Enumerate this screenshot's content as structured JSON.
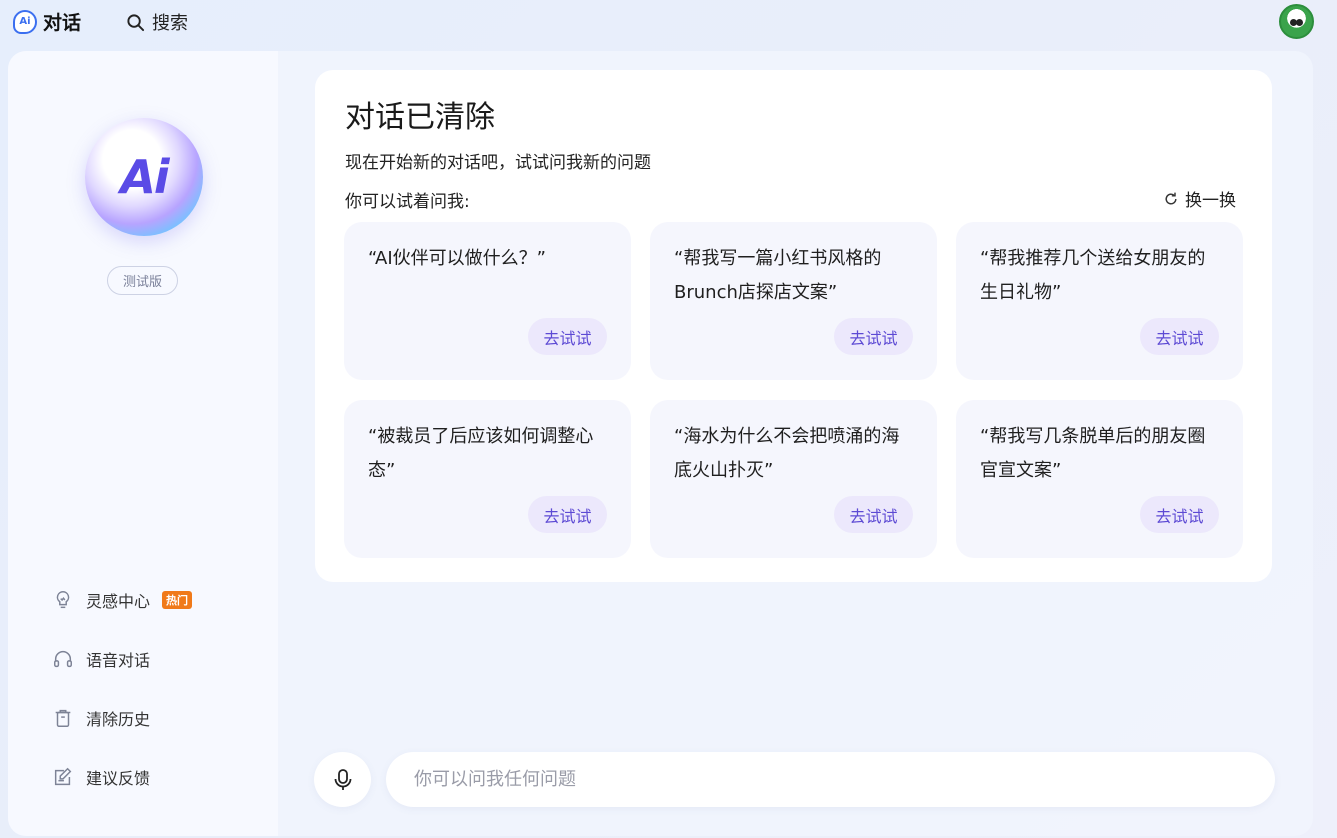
{
  "app": {
    "logo_text": "Ai",
    "title": "对话"
  },
  "topbar": {
    "search_label": "搜索"
  },
  "sidebar": {
    "logo_text": "Ai",
    "badge": "测试版",
    "items": [
      {
        "label": "灵感中心",
        "icon": "lightbulb-icon",
        "badge": "热门"
      },
      {
        "label": "语音对话",
        "icon": "headphones-icon"
      },
      {
        "label": "清除历史",
        "icon": "trash-icon"
      },
      {
        "label": "建议反馈",
        "icon": "feedback-icon"
      }
    ]
  },
  "main": {
    "title": "对话已清除",
    "subtitle": "现在开始新的对话吧，试试问我新的问题",
    "hint": "你可以试着问我:",
    "refresh_label": "换一换",
    "suggestions": [
      {
        "text": "“AI伙伴可以做什么？”",
        "button": "去试试"
      },
      {
        "text": "“帮我写一篇小红书风格的Brunch店探店文案”",
        "button": "去试试"
      },
      {
        "text": "“帮我推荐几个送给女朋友的生日礼物”",
        "button": "去试试"
      },
      {
        "text": "“被裁员了后应该如何调整心态”",
        "button": "去试试"
      },
      {
        "text": "“海水为什么不会把喷涌的海底火山扑灭”",
        "button": "去试试"
      },
      {
        "text": "“帮我写几条脱单后的朋友圈官宣文案”",
        "button": "去试试"
      }
    ]
  },
  "input": {
    "placeholder": "你可以问我任何问题",
    "value": ""
  },
  "colors": {
    "accent": "#5d4ad4",
    "hot_badge": "#f07a1a",
    "brand_blue": "#3b6ff0"
  }
}
